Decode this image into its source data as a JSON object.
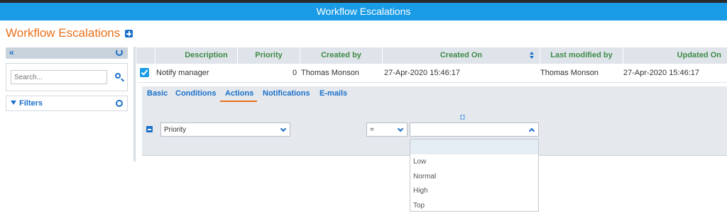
{
  "window": {
    "title": "Workflow Escalations"
  },
  "page": {
    "title": "Workflow Escalations"
  },
  "sidebar": {
    "search_placeholder": "Search...",
    "filters_label": "Filters"
  },
  "grid": {
    "columns": [
      "Description",
      "Priority",
      "Created by",
      "Created On",
      "Last modified by",
      "Updated On"
    ],
    "rows": [
      {
        "checked": true,
        "description": "Notify manager",
        "priority": "0",
        "created_by": "Thomas Monson",
        "created_on": "27-Apr-2020 15:46:17",
        "last_modified_by": "Thomas Monson",
        "updated_on": "27-Apr-2020 15:46:17"
      }
    ]
  },
  "detail": {
    "tabs": [
      "Basic",
      "Conditions",
      "Actions",
      "Notifications",
      "E-mails"
    ],
    "active_tab": "Actions",
    "action": {
      "field": "Priority",
      "operator": "=",
      "value": ""
    },
    "dropdown_options": [
      "",
      "Low",
      "Normal",
      "High",
      "Top"
    ]
  },
  "colors": {
    "titlebar": "#1a9be6",
    "page_title": "#e8701a",
    "accent": "#1a6fc9",
    "header_text": "#3f8a46"
  }
}
